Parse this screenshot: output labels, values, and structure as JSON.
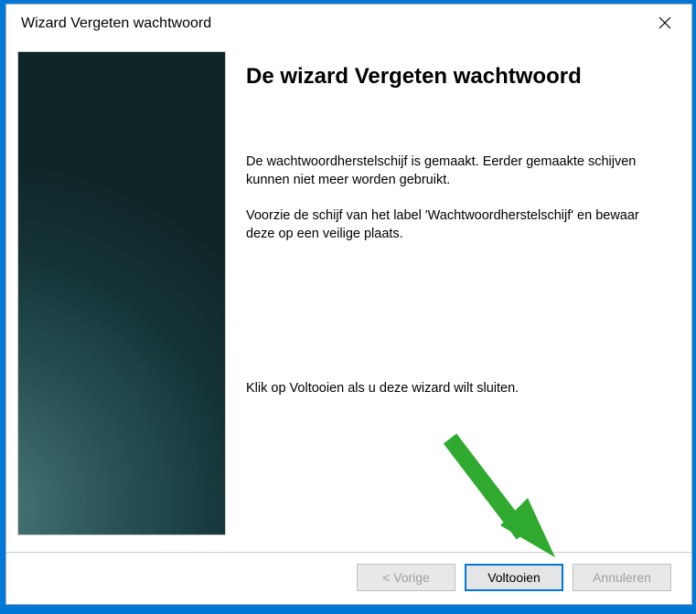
{
  "titlebar": {
    "title": "Wizard Vergeten wachtwoord"
  },
  "main": {
    "heading": "De wizard Vergeten wachtwoord",
    "para1": "De wachtwoordherstelschijf is gemaakt. Eerder gemaakte schijven kunnen niet meer worden gebruikt.",
    "para2": "Voorzie de schijf van het label 'Wachtwoordherstelschijf' en bewaar deze op een veilige plaats.",
    "footer": "Klik op Voltooien als u deze wizard wilt sluiten."
  },
  "buttons": {
    "back": "< Vorige",
    "finish": "Voltooien",
    "cancel": "Annuleren"
  }
}
